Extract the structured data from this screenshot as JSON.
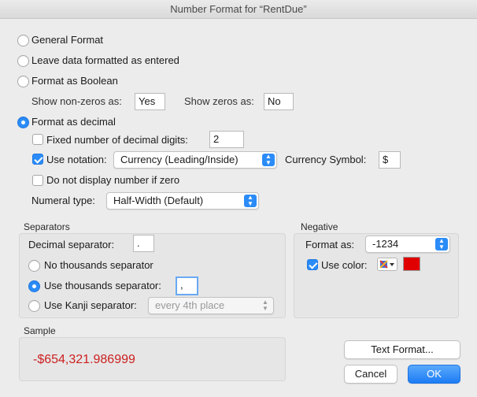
{
  "window": {
    "title": "Number Format for “RentDue”"
  },
  "format_options": {
    "general": "General Format",
    "leave": "Leave data formatted as entered",
    "boolean": "Format as Boolean",
    "decimal": "Format as decimal"
  },
  "boolean": {
    "nonzeros_label": "Show non-zeros as:",
    "nonzeros_value": "Yes",
    "zeros_label": "Show zeros as:",
    "zeros_value": "No"
  },
  "decimal": {
    "fixed_label": "Fixed number of decimal digits:",
    "fixed_value": "2",
    "notation_label": "Use notation:",
    "notation_value": "Currency (Leading/Inside)",
    "currency_label": "Currency Symbol:",
    "currency_value": "$",
    "no_zero_label": "Do not display number if zero",
    "numeral_label": "Numeral type:",
    "numeral_value": "Half-Width (Default)"
  },
  "separators": {
    "title": "Separators",
    "decimal_label": "Decimal separator:",
    "decimal_value": ".",
    "no_thousands": "No thousands separator",
    "use_thousands": "Use thousands separator:",
    "thousands_value": ",",
    "kanji": "Use Kanji separator:",
    "kanji_value": "every 4th place"
  },
  "negative": {
    "title": "Negative",
    "format_label": "Format as:",
    "format_value": "-1234",
    "color_label": "Use color:",
    "color_hex": "#e00000"
  },
  "sample": {
    "title": "Sample",
    "value": "-$654,321.986999"
  },
  "buttons": {
    "text_format": "Text Format...",
    "cancel": "Cancel",
    "ok": "OK"
  }
}
